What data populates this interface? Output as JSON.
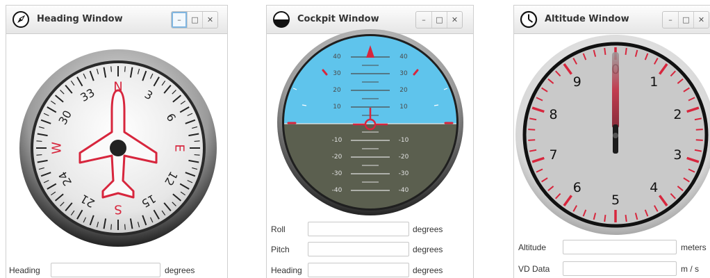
{
  "heading_window": {
    "title": "Heading Window",
    "icon": "compass-icon",
    "buttons": [
      "minimize",
      "maximize",
      "close"
    ],
    "compass_labels": [
      "N",
      "3",
      "6",
      "E",
      "12",
      "15",
      "S",
      "21",
      "24",
      "W",
      "30",
      "33"
    ],
    "field_label": "Heading",
    "field_value": "",
    "unit": "degrees"
  },
  "cockpit_window": {
    "title": "Cockpit Window",
    "icon": "attitude-icon",
    "buttons": [
      "minimize",
      "maximize",
      "close"
    ],
    "pitch_labels_up": [
      "40",
      "30",
      "20",
      "10"
    ],
    "pitch_labels_down": [
      "-10",
      "-20",
      "-30",
      "-40"
    ],
    "rows": [
      {
        "label": "Roll",
        "value": "",
        "unit": "degrees"
      },
      {
        "label": "Pitch",
        "value": "",
        "unit": "degrees"
      },
      {
        "label": "Heading",
        "value": "",
        "unit": "degrees"
      }
    ],
    "sky_color": "#5fc4ec",
    "ground_color": "#5b5f4f"
  },
  "altitude_window": {
    "title": "Altitude Window",
    "icon": "clock-icon",
    "buttons": [
      "minimize",
      "maximize",
      "close"
    ],
    "dial_numbers": [
      "0",
      "1",
      "2",
      "3",
      "4",
      "5",
      "6",
      "7",
      "8",
      "9"
    ],
    "rows": [
      {
        "label": "Altitude",
        "value": "",
        "unit": "meters"
      },
      {
        "label": "VD Data",
        "value": "",
        "unit": "m / s"
      }
    ]
  },
  "colors": {
    "accent_red": "#d7263d",
    "title_bar": "#e6e6e6"
  }
}
